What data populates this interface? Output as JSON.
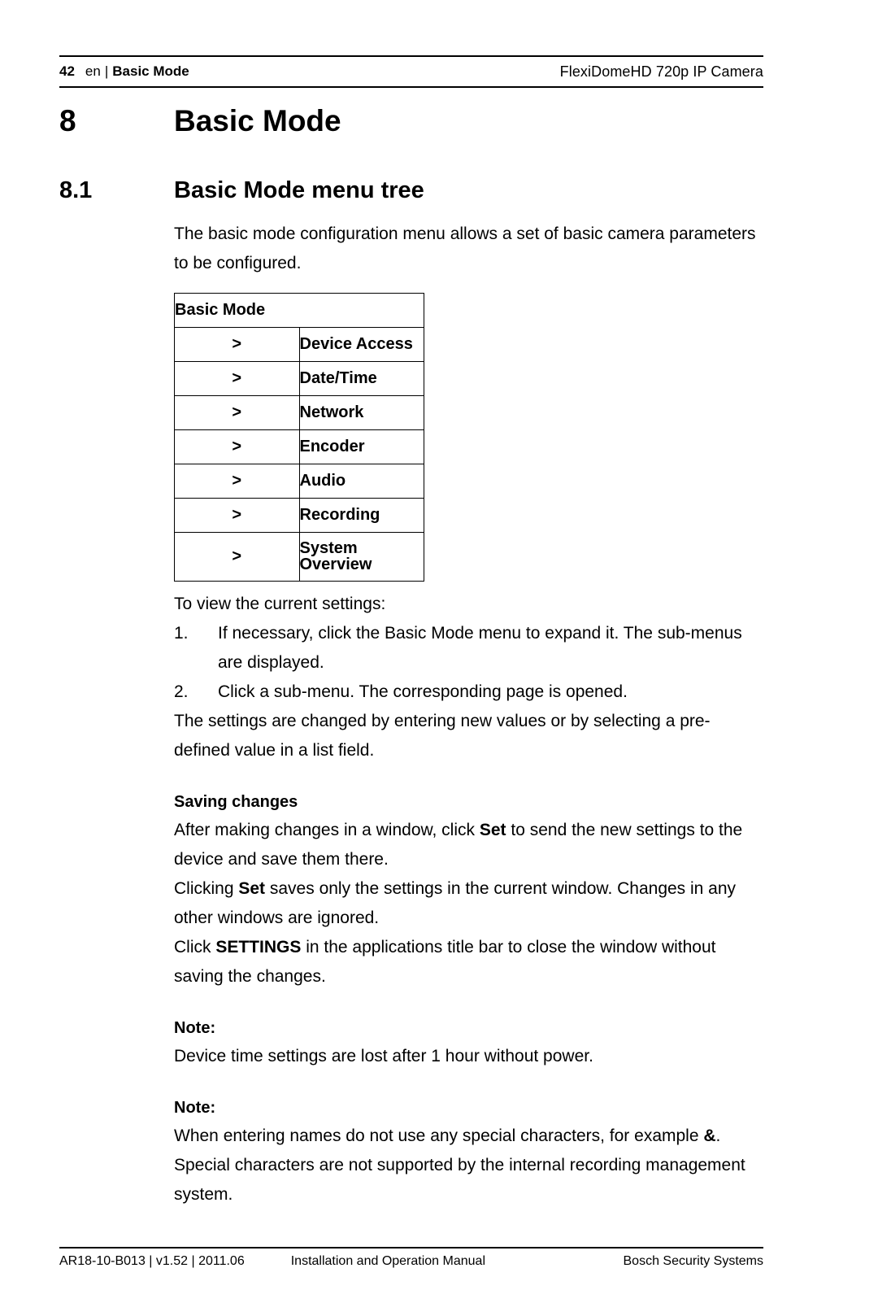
{
  "header": {
    "page_number": "42",
    "language": "en",
    "separator": "|",
    "section": "Basic Mode",
    "product": "FlexiDomeHD 720p IP Camera"
  },
  "headings": {
    "chapter_number": "8",
    "chapter_title": "Basic Mode",
    "section_number": "8.1",
    "section_title": "Basic Mode menu tree"
  },
  "intro": {
    "paragraph": "The basic mode configuration menu allows a set of basic camera parameters to be configured."
  },
  "menu_tree": {
    "title": "Basic Mode",
    "arrow": ">",
    "items": [
      {
        "label": "Device Access"
      },
      {
        "label": "Date/Time"
      },
      {
        "label": "Network"
      },
      {
        "label": "Encoder"
      },
      {
        "label": "Audio"
      },
      {
        "label": "Recording"
      },
      {
        "label": "System Overview"
      }
    ]
  },
  "procedure": {
    "lead_in": "To view the current settings:",
    "steps": [
      {
        "number": "1.",
        "text": "If necessary, click the Basic Mode menu to expand it. The sub-menus are displayed."
      },
      {
        "number": "2.",
        "text": "Click a sub-menu. The corresponding page is opened."
      }
    ],
    "closing": "The settings are changed by entering new values or by selecting a pre-defined value in a list field."
  },
  "saving_changes": {
    "heading": "Saving changes",
    "p1_part1": "After making changes in a window, click ",
    "p1_bold": "Set",
    "p1_part2": " to send the new settings to the device and save them there.",
    "p2_part1": "Clicking ",
    "p2_bold": "Set",
    "p2_part2": " saves only the settings in the current window. Changes in any other windows are ignored.",
    "p3_part1": "Click ",
    "p3_bold": "SETTINGS",
    "p3_part2": " in the applications title bar to close the window without saving the changes."
  },
  "notes": [
    {
      "heading": "Note:",
      "body": "Device time settings are lost after 1 hour without power."
    },
    {
      "heading": "Note:",
      "body_part1": "When entering names do not use any special characters, for example ",
      "body_bold": "&",
      "body_part2": ". Special characters are not supported by the internal recording management system."
    }
  ],
  "footer": {
    "document_id": "AR18-10-B013 | v1.52 | 2011.06",
    "manual_title": "Installation and Operation Manual",
    "company": "Bosch Security Systems"
  }
}
